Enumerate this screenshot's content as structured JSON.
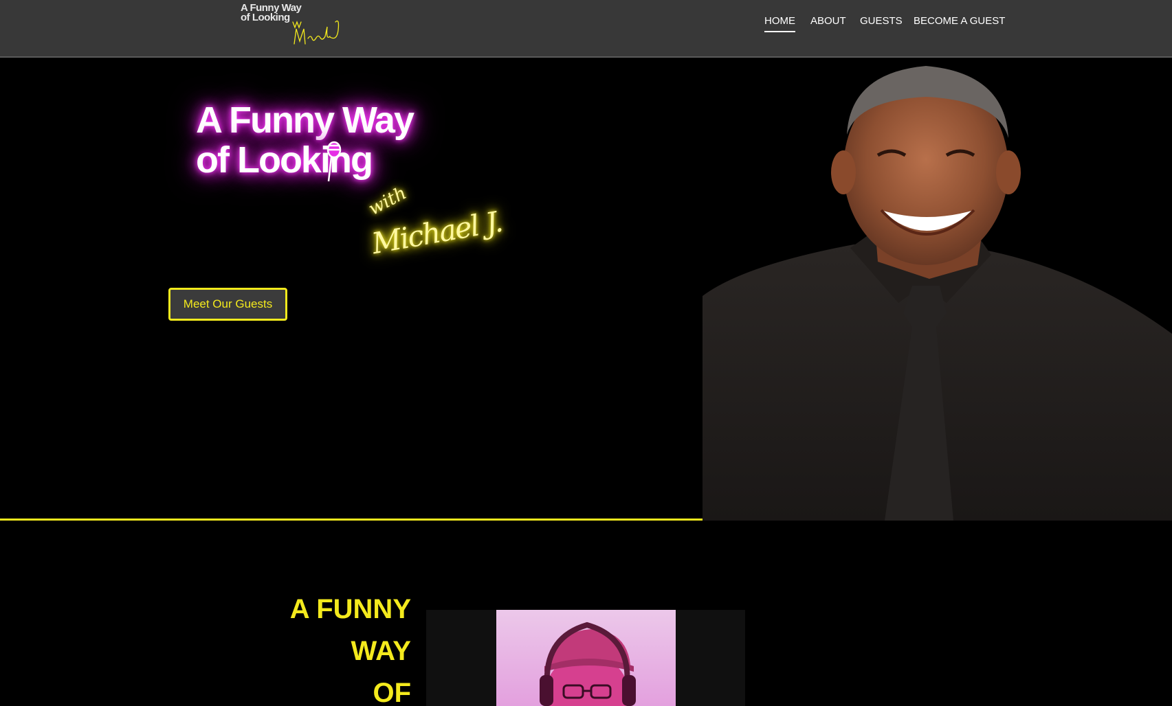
{
  "header": {
    "logo": {
      "line1": "A Funny Way",
      "line2": "of Looking",
      "script": "with Michael J."
    },
    "nav": [
      {
        "label": "HOME",
        "active": true
      },
      {
        "label": "ABOUT",
        "active": false
      },
      {
        "label": "GUESTS",
        "active": false
      },
      {
        "label": "BECOME A GUEST",
        "active": false
      }
    ]
  },
  "hero": {
    "title_line1": "A Funny Way",
    "title_line2": "of Looking",
    "script_line1": "with",
    "script_line2": "Michael J.",
    "button_label": "Meet Our Guests"
  },
  "section2": {
    "heading_lines": [
      "A FUNNY",
      "WAY",
      "OF"
    ]
  },
  "colors": {
    "accent_yellow": "#f4ea1d",
    "neon_pink": "#e62ee6",
    "header_bg": "#383838",
    "page_bg": "#000000"
  }
}
